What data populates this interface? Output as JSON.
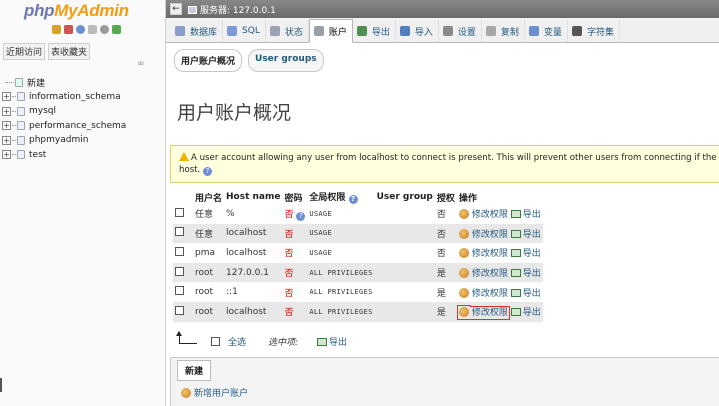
{
  "logo": {
    "php": "php",
    "myadmin": "MyAdmin"
  },
  "left_nav": {
    "recent": "近期访问",
    "favorites": "表收藏夹",
    "new_label": "新建",
    "databases": [
      "information_schema",
      "mysql",
      "performance_schema",
      "phpmyadmin",
      "test"
    ]
  },
  "server_bar": {
    "label": "服务器: 127.0.0.1"
  },
  "tabs": [
    {
      "label": "数据库",
      "icon": "database-icon",
      "color": "#8a9cc8"
    },
    {
      "label": "SQL",
      "icon": "sql-icon",
      "color": "#7b9ad6"
    },
    {
      "label": "状态",
      "icon": "status-icon",
      "color": "#9aa2b5"
    },
    {
      "label": "账户",
      "icon": "users-icon",
      "color": "#9aa0a8",
      "active": true
    },
    {
      "label": "导出",
      "icon": "export-icon",
      "color": "#4f8f4f"
    },
    {
      "label": "导入",
      "icon": "import-icon",
      "color": "#4f7fbf"
    },
    {
      "label": "设置",
      "icon": "wrench-icon",
      "color": "#8a8a8a"
    },
    {
      "label": "复制",
      "icon": "replication-icon",
      "color": "#a8a8a8"
    },
    {
      "label": "变量",
      "icon": "variables-icon",
      "color": "#6b8fd1"
    },
    {
      "label": "字符集",
      "icon": "charset-icon",
      "color": "#555555"
    }
  ],
  "subtabs": {
    "overview": "用户账户概况",
    "groups": "User groups"
  },
  "page_title": "用户账户概况",
  "notice": {
    "line1": "A user account allowing any user from localhost to connect is present. This will prevent other users from connecting if the host p",
    "line2": "host."
  },
  "table": {
    "headers": {
      "user": "用户名",
      "host": "Host name",
      "password": "密码",
      "privileges": "全局权限",
      "group": "User group",
      "grant": "授权",
      "action": "操作"
    },
    "rows": [
      {
        "user": "任意",
        "host": "%",
        "password": "否",
        "privileges": "USAGE",
        "grant": "否",
        "edit": "修改权限",
        "export": "导出",
        "user_red": true,
        "pw_help": true
      },
      {
        "user": "任意",
        "host": "localhost",
        "password": "否",
        "privileges": "USAGE",
        "grant": "否",
        "edit": "修改权限",
        "export": "导出",
        "user_red": true
      },
      {
        "user": "pma",
        "host": "localhost",
        "password": "否",
        "privileges": "USAGE",
        "grant": "否",
        "edit": "修改权限",
        "export": "导出"
      },
      {
        "user": "root",
        "host": "127.0.0.1",
        "password": "否",
        "privileges": "ALL PRIVILEGES",
        "grant": "是",
        "edit": "修改权限",
        "export": "导出"
      },
      {
        "user": "root",
        "host": "::1",
        "password": "否",
        "privileges": "ALL PRIVILEGES",
        "grant": "是",
        "edit": "修改权限",
        "export": "导出"
      },
      {
        "user": "root",
        "host": "localhost",
        "password": "否",
        "privileges": "ALL PRIVILEGES",
        "grant": "是",
        "edit": "修改权限",
        "export": "导出",
        "highlight": true
      }
    ]
  },
  "bulk": {
    "check_all": "全选",
    "with_selected": "选中项:",
    "export": "导出"
  },
  "new_section": {
    "legend": "新建",
    "add_user": "新增用户账户"
  }
}
